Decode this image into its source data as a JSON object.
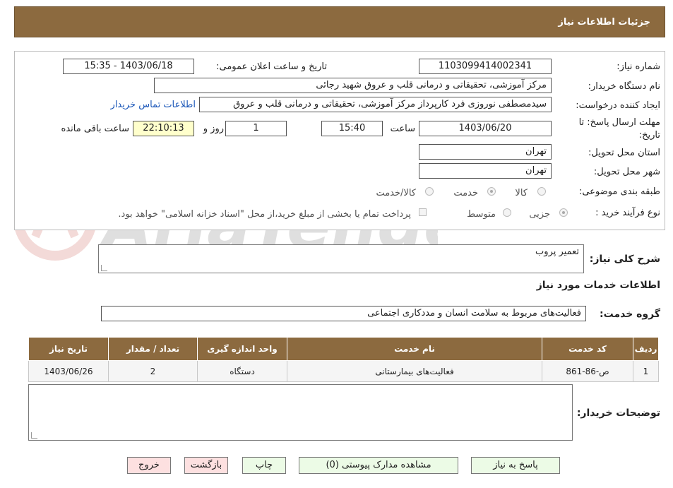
{
  "header": {
    "title": "جزئیات اطلاعات نیاز"
  },
  "watermark": {
    "text": "AriaTender.neT"
  },
  "form": {
    "need_number_label": "شماره نیاز:",
    "need_number": "1103099414002341",
    "announce_label": "تاریخ و ساعت اعلان عمومی:",
    "announce_value": "1403/06/18 - 15:35",
    "buyer_org_label": "نام دستگاه خریدار:",
    "buyer_org": "مرکز آموزشی، تحقیقاتی و درمانی قلب و عروق شهید رجائی",
    "requester_label": "ایجاد کننده درخواست:",
    "requester": "سیدمصطفی نوروزی فرد کارپرداز مرکز آموزشی، تحقیقاتی و درمانی قلب و عروق",
    "contact_link": "اطلاعات تماس خریدار",
    "deadline_label_1": "مهلت ارسال پاسخ: تا",
    "deadline_label_2": "تاریخ:",
    "deadline_date": "1403/06/20",
    "time_label": "ساعت",
    "deadline_time": "15:40",
    "days_value": "1",
    "days_label": "روز و",
    "remaining_time": "22:10:13",
    "remaining_label": "ساعت باقی مانده",
    "province_label": "استان محل تحویل:",
    "province": "تهران",
    "city_label": "شهر محل تحویل:",
    "city": "تهران",
    "category_label": "طبقه بندی موضوعی:",
    "category_options": [
      "کالا",
      "خدمت",
      "کالا/خدمت"
    ],
    "process_label": "نوع فرآیند خرید :",
    "process_options": [
      "جزیی",
      "متوسط"
    ],
    "payment_note": "پرداخت تمام یا بخشی از مبلغ خرید،از محل \"اسناد خزانه اسلامی\" خواهد بود."
  },
  "summary": {
    "label": "شرح کلی نیاز:",
    "value": "تعمیر پروب"
  },
  "services_section": {
    "title": "اطلاعات خدمات مورد نیاز"
  },
  "service_group": {
    "label": "گروه خدمت:",
    "value": "فعالیت‌های مربوط به سلامت انسان و مددکاری اجتماعی"
  },
  "table": {
    "headers": [
      "ردیف",
      "کد خدمت",
      "نام خدمت",
      "واحد اندازه گیری",
      "تعداد / مقدار",
      "تاریخ نیاز"
    ],
    "rows": [
      [
        "1",
        "ص-86-861",
        "فعالیت‌های بیمارستانی",
        "دستگاه",
        "2",
        "1403/06/26"
      ]
    ]
  },
  "buyer_notes": {
    "label": "توضیحات خریدار:",
    "value": ""
  },
  "buttons": {
    "reply": "پاسخ به نیاز",
    "attachments": "مشاهده مدارک پیوستی (0)",
    "print": "چاپ",
    "back": "بازگشت",
    "exit": "خروج"
  }
}
